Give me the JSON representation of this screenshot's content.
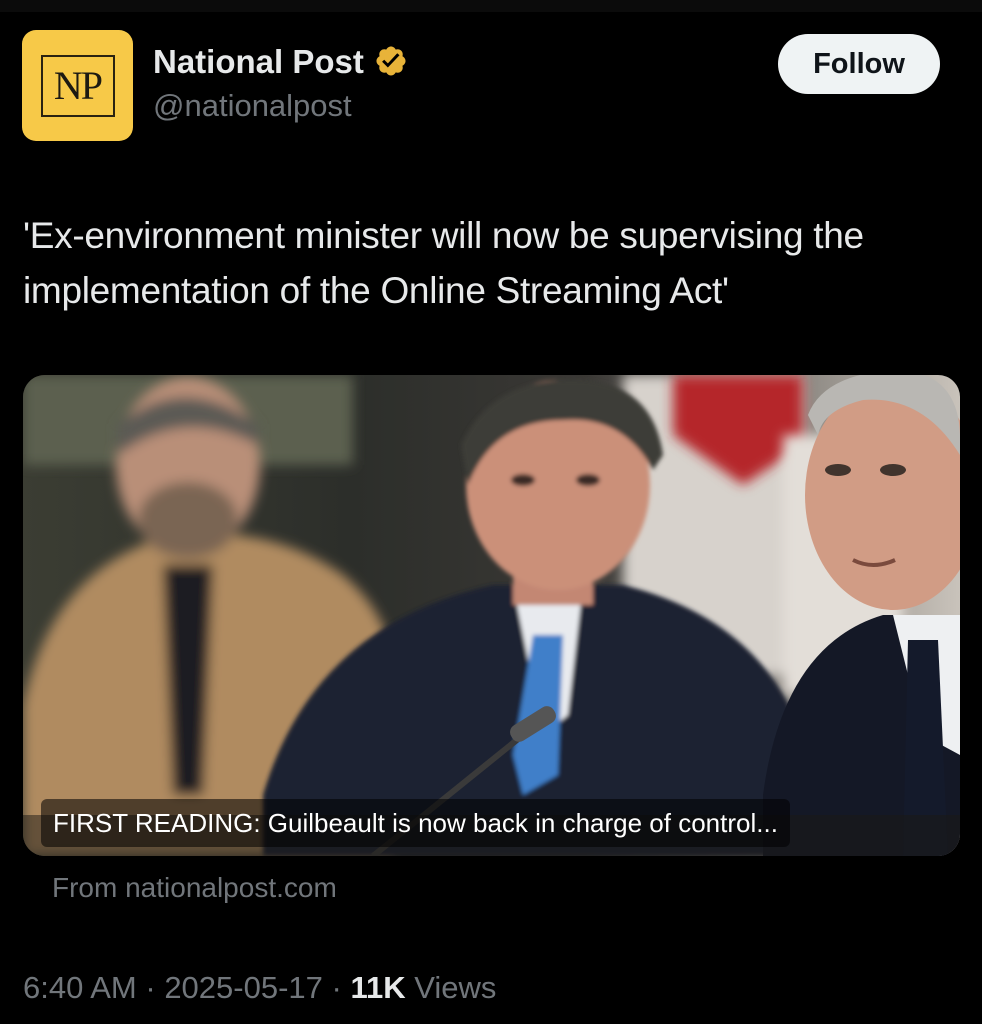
{
  "account": {
    "avatar_text": "NP",
    "display_name": "National Post",
    "handle": "@nationalpost",
    "verified_icon": "gold-verified-badge-icon",
    "avatar_color": "#f7c948",
    "badge_color": "#e8b339"
  },
  "actions": {
    "follow_label": "Follow"
  },
  "tweet": {
    "text": "'Ex-environment minister will now be supervising the implementation of the Online Streaming Act'"
  },
  "card": {
    "caption": "FIRST READING: Guilbeault is now back in charge of control...",
    "source": "From nationalpost.com"
  },
  "meta": {
    "time": "6:40 AM",
    "separator": " · ",
    "date": "2025-05-17",
    "views_count": "11K",
    "views_label": "Views"
  },
  "colors": {
    "background": "#000000",
    "text_primary": "#e7e9ea",
    "text_secondary": "#71767b",
    "follow_bg": "#eff3f4"
  }
}
